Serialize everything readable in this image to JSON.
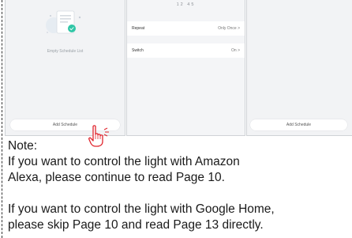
{
  "screens": {
    "phone1": {
      "empty_label": "Empty Schedule List",
      "button_label": "Add Schedule"
    },
    "phone2": {
      "time": "12  45",
      "rows": [
        {
          "label": "Repeat",
          "value": "Only Once  >"
        },
        {
          "label": "Switch",
          "value": "On  >"
        }
      ]
    },
    "phone3": {
      "button_label": "Add Schedule"
    }
  },
  "note": {
    "title": "Note:",
    "lines": [
      "If you want to control the light with Amazon",
      "Alexa, please continue to read Page 10.",
      "If you want to control the light with Google Home,",
      "please skip Page 10 and read Page 13 directly."
    ]
  },
  "colors": {
    "screen_bg": "#f2f3f5",
    "accent": "#e0242c",
    "illustration_teal": "#2fc6a6"
  },
  "icons": [
    "empty-schedule-illustration",
    "hand-pointer-icon"
  ]
}
